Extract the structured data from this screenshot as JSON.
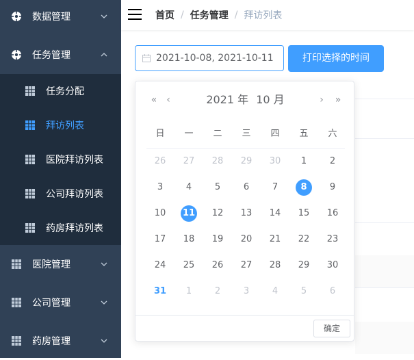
{
  "sidebar": {
    "menus": [
      {
        "label": "数据管理",
        "icon": "dashboard-icon",
        "arrow": "chevron-down-icon"
      },
      {
        "label": "任务管理",
        "icon": "dashboard-icon",
        "arrow": "chevron-up-icon"
      },
      {
        "label": "医院管理",
        "icon": "grid-icon",
        "arrow": "chevron-down-icon"
      },
      {
        "label": "公司管理",
        "icon": "grid-icon",
        "arrow": "chevron-down-icon"
      },
      {
        "label": "药房管理",
        "icon": "grid-icon",
        "arrow": "chevron-down-icon"
      }
    ],
    "submenu": [
      {
        "label": "任务分配",
        "icon": "grid-icon"
      },
      {
        "label": "拜访列表",
        "icon": "grid-icon",
        "active": true
      },
      {
        "label": "医院拜访列表",
        "icon": "grid-icon"
      },
      {
        "label": "公司拜访列表",
        "icon": "grid-icon"
      },
      {
        "label": "药房拜访列表",
        "icon": "grid-icon"
      }
    ],
    "colors": {
      "bg": "#304156",
      "sub_bg": "#1f2d3d",
      "active": "#409eff"
    }
  },
  "header": {
    "breadcrumb": [
      "首页",
      "任务管理",
      "拜访列表"
    ],
    "separator": "/"
  },
  "toolbar": {
    "date_range_value": "2021-10-08, 2021-10-11",
    "print_button_label": "打印选择的时间"
  },
  "picker": {
    "year_label": "2021 年",
    "month_label": "10 月",
    "nav": {
      "prev_year": "«",
      "prev_month": "‹",
      "next_month": "›",
      "next_year": "»"
    },
    "weekdays": [
      "日",
      "一",
      "二",
      "三",
      "四",
      "五",
      "六"
    ],
    "weeks": [
      [
        "26",
        "27",
        "28",
        "29",
        "30",
        "1",
        "2"
      ],
      [
        "3",
        "4",
        "5",
        "6",
        "7",
        "8",
        "9"
      ],
      [
        "10",
        "11",
        "12",
        "13",
        "14",
        "15",
        "16"
      ],
      [
        "17",
        "18",
        "19",
        "20",
        "21",
        "22",
        "23"
      ],
      [
        "24",
        "25",
        "26",
        "27",
        "28",
        "29",
        "30"
      ],
      [
        "31",
        "1",
        "2",
        "3",
        "4",
        "5",
        "6"
      ]
    ],
    "selected_days": [
      "8",
      "11"
    ],
    "today": "31",
    "confirm_label": "确定",
    "accent_color": "#409eff"
  }
}
